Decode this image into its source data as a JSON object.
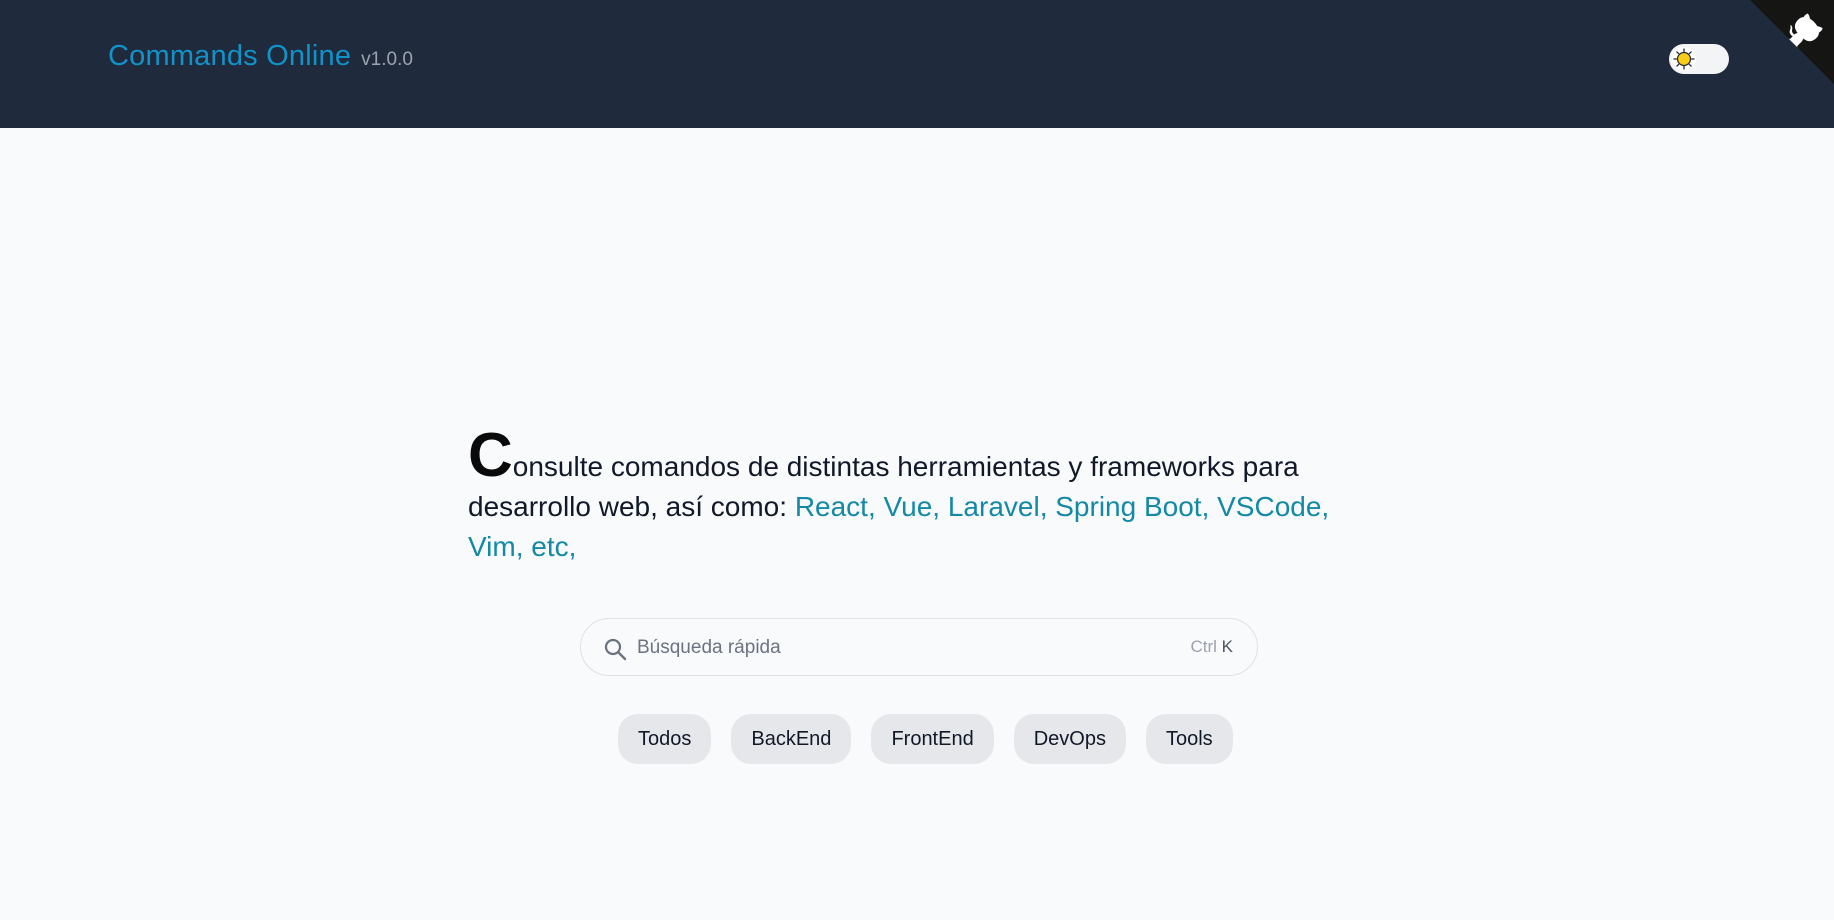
{
  "header": {
    "title": "Commands Online",
    "version": "v1.0.0"
  },
  "theme_toggle": {
    "icon": "sun-icon",
    "state": "light",
    "sun_color": "#facc15"
  },
  "github_corner": {
    "icon": "github-octocat-icon"
  },
  "hero": {
    "dropcap": "C",
    "text": "onsulte comandos de distintas herramientas y frameworks para desarrollo web, así como: ",
    "highlight": "React, Vue, Laravel, Spring Boot, VSCode, Vim, etc,"
  },
  "search": {
    "placeholder": "Búsqueda rápida",
    "value": "",
    "shortcut_modifier": "Ctrl",
    "shortcut_key": "K",
    "icon": "search-icon"
  },
  "filters": [
    "Todos",
    "BackEnd",
    "FrontEnd",
    "DevOps",
    "Tools"
  ],
  "colors": {
    "navbar_bg": "#1f2a3c",
    "brand": "#1192c9",
    "highlight": "#1389a6",
    "page_bg": "#f8fafc",
    "chip_bg": "#e5e7eb"
  }
}
